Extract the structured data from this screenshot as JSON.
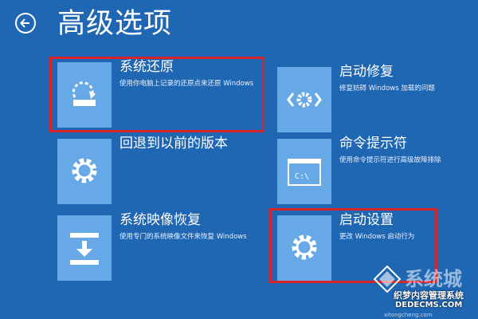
{
  "header": {
    "title": "高级选项"
  },
  "options": [
    {
      "name": "系统还原",
      "desc": "使用你电脑上记录的还原点来还原 Windows"
    },
    {
      "name": "启动修复",
      "desc": "修复妨碍 Windows 加载的问题"
    },
    {
      "name": "回退到以前的版本",
      "desc": ""
    },
    {
      "name": "命令提示符",
      "desc": "使用命令提示符进行高级故障排除",
      "icon_text": "C:\\"
    },
    {
      "name": "系统映像恢复",
      "desc": "使用专门的系统映像文件来恢复 Windows"
    },
    {
      "name": "启动设置",
      "desc": "更改 Windows 启动行为"
    }
  ],
  "watermark": {
    "big": "系统城",
    "mid": "织梦内容管理系统",
    "url": "DEDECMS.COM",
    "site": "xitongcheng.com"
  },
  "colors": {
    "background": "#1f66b3",
    "tile": "#66a9e6",
    "highlight": "#d8232a"
  }
}
